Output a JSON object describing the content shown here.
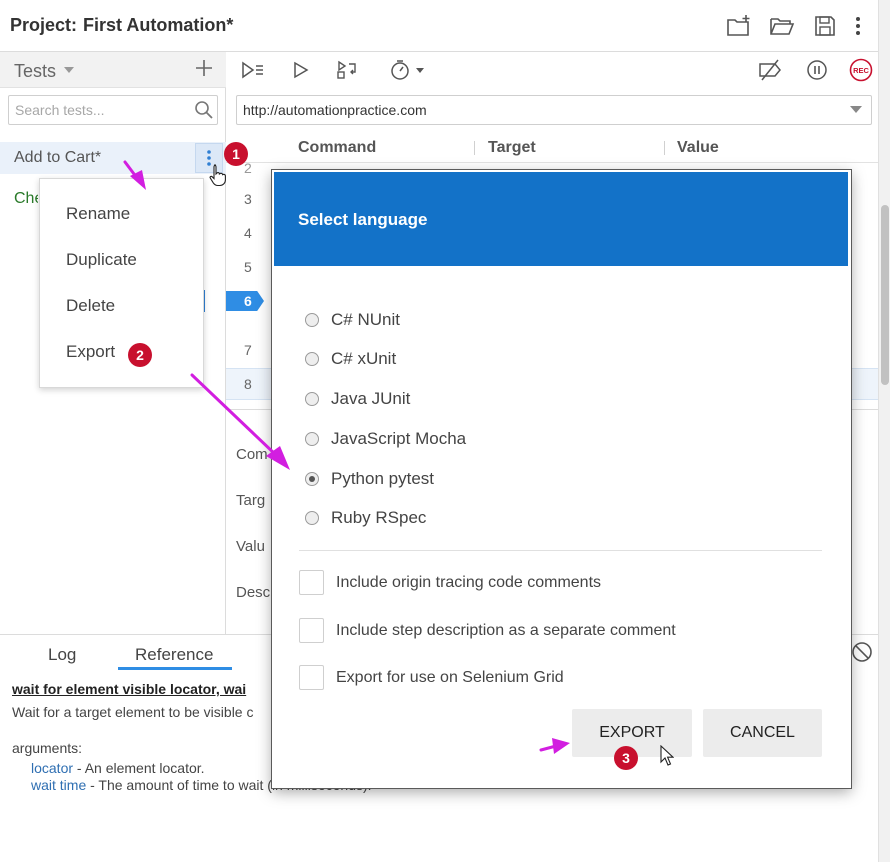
{
  "header": {
    "project_label": "Project:",
    "project_name": "First Automation*",
    "icons": [
      "new-project-icon",
      "open-folder-icon",
      "save-icon",
      "more-vertical-icon"
    ]
  },
  "tests_panel": {
    "title": "Tests",
    "search_placeholder": "Search tests...",
    "items": [
      {
        "label": "Add to Cart*",
        "selected": true
      },
      {
        "label": "Checkout",
        "color": "#2a7a2a"
      }
    ]
  },
  "context_menu": {
    "items": [
      "Rename",
      "Duplicate",
      "Delete",
      "Export"
    ]
  },
  "toolbar": {
    "icons": [
      "run-all-tests-icon",
      "run-current-test-icon",
      "step-over-icon",
      "speed-timer-icon",
      "disable-breakpoints-icon",
      "pause-icon",
      "record-icon"
    ],
    "record_label": "REC"
  },
  "url": {
    "value": "http://automationpractice.com"
  },
  "grid": {
    "columns": [
      "Command",
      "Target",
      "Value"
    ],
    "row_numbers": [
      "3",
      "4",
      "5",
      "6",
      "7",
      "8"
    ],
    "current_row": "6",
    "partial_row": "2"
  },
  "details": {
    "labels": [
      "Com",
      "Targ",
      "Valu",
      "Desc"
    ]
  },
  "bottom_panel": {
    "tabs": [
      "Log",
      "Reference"
    ],
    "active_tab": "Reference",
    "reference": {
      "command_line": "wait for element visible  locator, wai",
      "description": "Wait for a target element to be visible c",
      "arguments_label": "arguments:",
      "args": [
        {
          "name": "locator",
          "text": " - An element locator."
        },
        {
          "name": "wait time",
          "text": " - The amount of time to wait (in milliseconds)."
        }
      ]
    }
  },
  "modal": {
    "title": "Select language",
    "languages": [
      "C# NUnit",
      "C# xUnit",
      "Java JUnit",
      "JavaScript Mocha",
      "Python pytest",
      "Ruby RSpec"
    ],
    "selected_language": "Python pytest",
    "options": [
      "Include origin tracing code comments",
      "Include step description as a separate comment",
      "Export for use on Selenium Grid"
    ],
    "buttons": {
      "export": "EXPORT",
      "cancel": "CANCEL"
    }
  },
  "annotations": {
    "badges": [
      "1",
      "2",
      "3"
    ],
    "arrow_color": "#d21ee0",
    "badge_color": "#c8102e"
  },
  "colors": {
    "modal_header": "#1372c8",
    "accent": "#2f8de4"
  }
}
